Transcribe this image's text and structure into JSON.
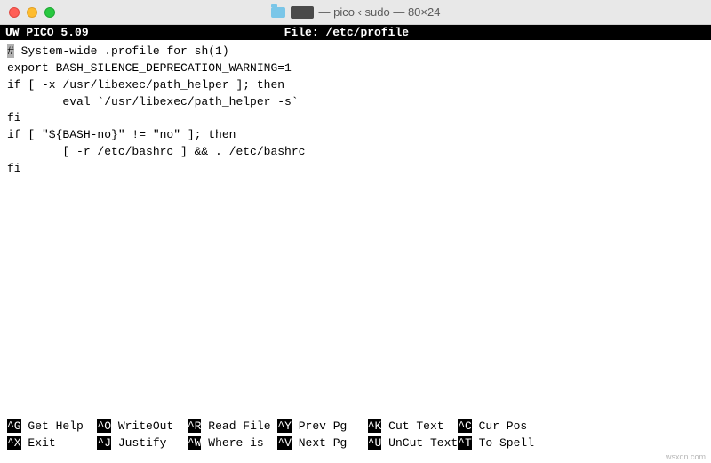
{
  "window": {
    "title": "— pico ‹ sudo — 80×24"
  },
  "status": {
    "app": " UW PICO 5.09 ",
    "file_label": "File: /etc/profile"
  },
  "content": {
    "cursor_char": "#",
    "line1_rest": " System-wide .profile for sh(1)",
    "line2": "export BASH_SILENCE_DEPRECATION_WARNING=1",
    "line3": "if [ -x /usr/libexec/path_helper ]; then",
    "line4": "        eval `/usr/libexec/path_helper -s`",
    "line5": "fi",
    "line6": "",
    "line7": "if [ \"${BASH-no}\" != \"no\" ]; then",
    "line8": "        [ -r /etc/bashrc ] && . /etc/bashrc",
    "line9": "fi"
  },
  "shortcuts": {
    "g_key": "^G",
    "g_lbl": " Get Help  ",
    "o_key": "^O",
    "o_lbl": " WriteOut  ",
    "r_key": "^R",
    "r_lbl": " Read File ",
    "y_key": "^Y",
    "y_lbl": " Prev Pg   ",
    "k_key": "^K",
    "k_lbl": " Cut Text  ",
    "c_key": "^C",
    "c_lbl": " Cur Pos   ",
    "x_key": "^X",
    "x_lbl": " Exit      ",
    "j_key": "^J",
    "j_lbl": " Justify   ",
    "w_key": "^W",
    "w_lbl": " Where is  ",
    "v_key": "^V",
    "v_lbl": " Next Pg   ",
    "u_key": "^U",
    "u_lbl": " UnCut Text",
    "t_key": "^T",
    "t_lbl": " To Spell  "
  },
  "watermark": "wsxdn.com"
}
